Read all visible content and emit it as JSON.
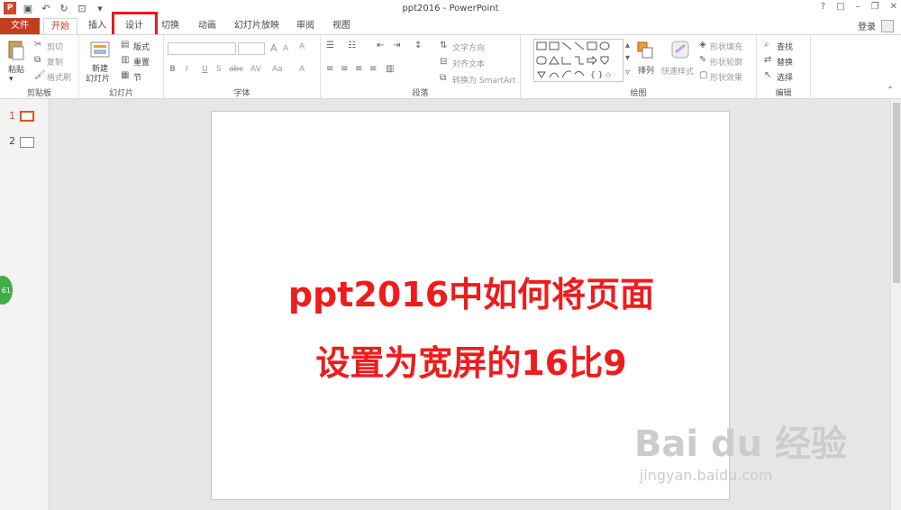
{
  "window": {
    "title": "ppt2016 - PowerPoint",
    "login": "登录",
    "controls": [
      "?",
      "□",
      "–",
      "❐",
      "✕"
    ]
  },
  "tabs": [
    {
      "label": "文件"
    },
    {
      "label": "开始"
    },
    {
      "label": "插入"
    },
    {
      "label": "设计"
    },
    {
      "label": "切换"
    },
    {
      "label": "动画"
    },
    {
      "label": "幻灯片放映"
    },
    {
      "label": "审阅"
    },
    {
      "label": "视图"
    }
  ],
  "ribbon": {
    "clipboard": {
      "paste": "粘贴",
      "cut": "剪切",
      "copy": "复制",
      "format_painter": "格式刷",
      "group": "剪贴板"
    },
    "slides": {
      "new_slide": "新建",
      "new_slide2": "幻灯片",
      "layout": "版式",
      "reset": "重置",
      "section": "节",
      "group": "幻灯片"
    },
    "font": {
      "group": "字体",
      "bold": "B",
      "italic": "I",
      "underline": "U",
      "strike": "S",
      "spacing": "abc",
      "aa": "AV",
      "case": "Aa",
      "color": "A",
      "grow": "A",
      "shrink": "A",
      "clear": "A"
    },
    "paragraph": {
      "text_direction": "文字方向",
      "align_text": "对齐文本",
      "smartart": "转换为 SmartArt",
      "group": "段落"
    },
    "drawing": {
      "arrange": "排列",
      "quick_styles": "快速样式",
      "fill": "形状填充",
      "outline": "形状轮廓",
      "effects": "形状效果",
      "group": "绘图"
    },
    "editing": {
      "find": "查找",
      "replace": "替换",
      "select": "选择",
      "group": "编辑"
    }
  },
  "slides_pane": [
    {
      "num": "1"
    },
    {
      "num": "2"
    }
  ],
  "slide": {
    "line1": "ppt2016中如何将页面",
    "line2": "设置为宽屏的16比9"
  },
  "badge": "61",
  "watermark": {
    "brand": "Bai du 经验",
    "url": "jingyan.baidu.com"
  },
  "colors": {
    "accent": "#c43e1c",
    "highlight": "#e8191f",
    "slide_text": "#ee1c1c"
  }
}
